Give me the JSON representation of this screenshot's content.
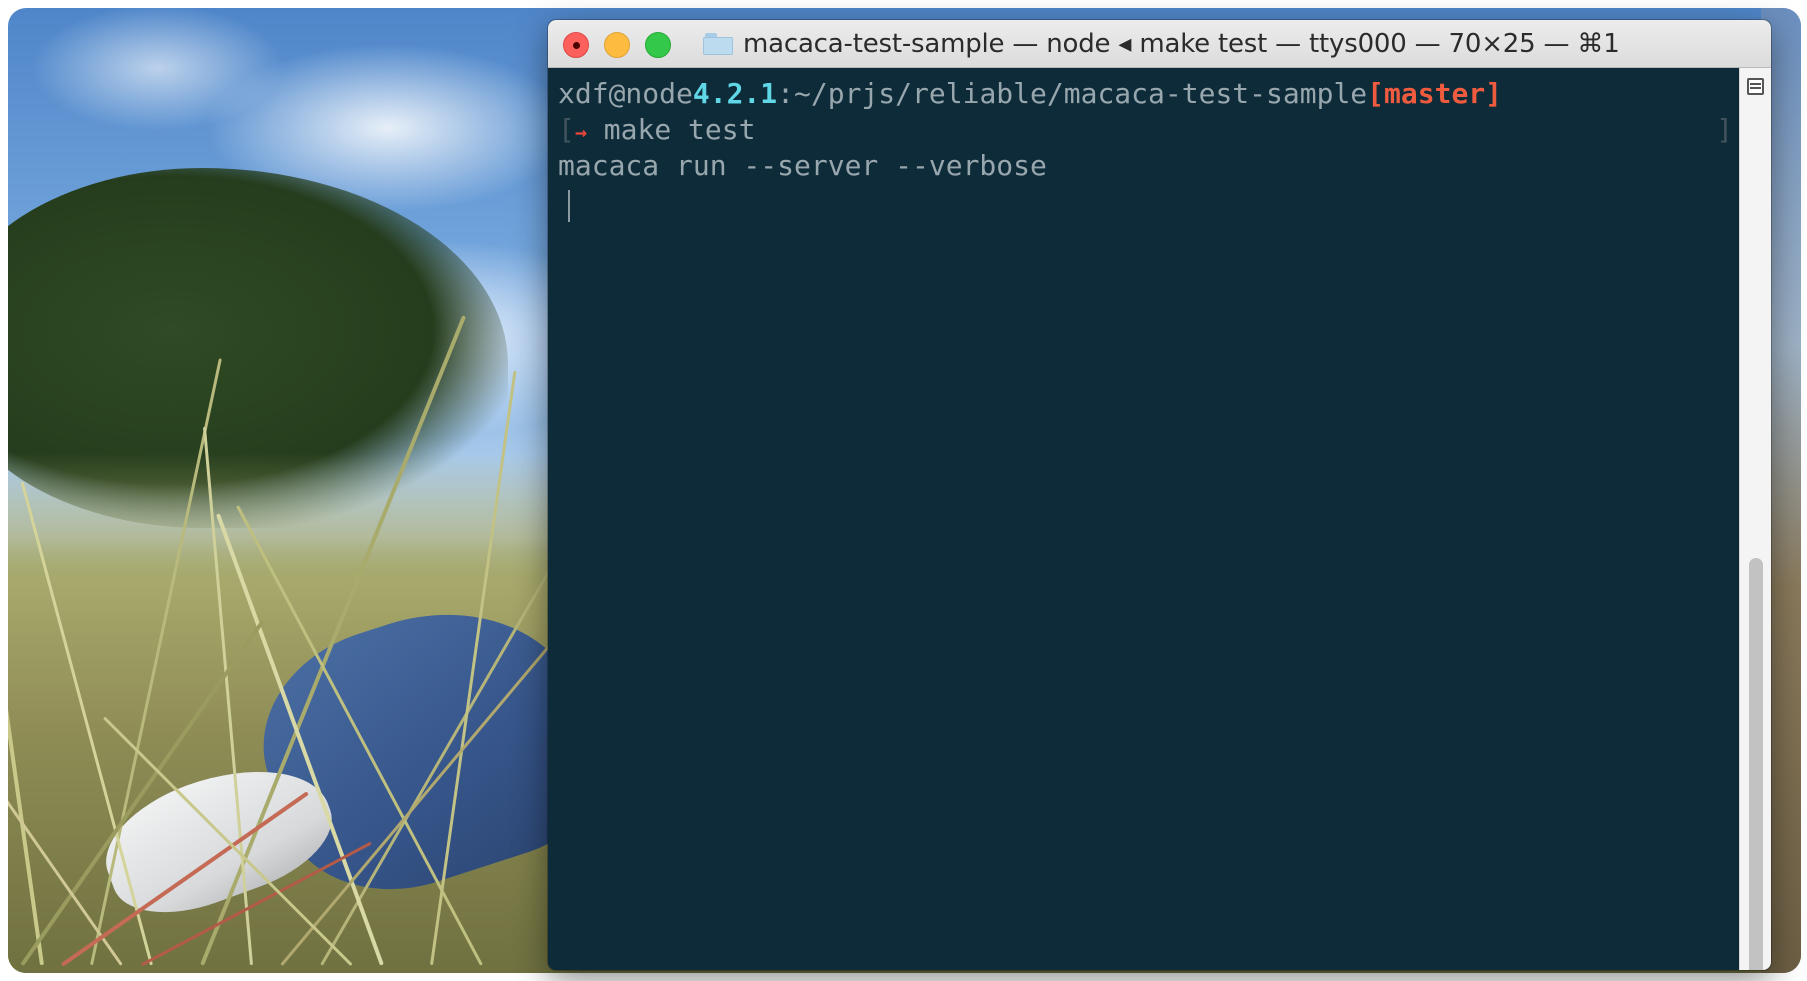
{
  "window": {
    "title": "macaca-test-sample — node ◂ make test — ttys000 — 70×25 — ⌘1"
  },
  "terminal": {
    "prompt": {
      "user_host": "xdf@node",
      "node_version": "4.2.1",
      "path": ":~/prjs/reliable/macaca-test-sample",
      "branch": "[master]"
    },
    "command_line": {
      "open_bracket": "[",
      "arrow": "→",
      "command": " make test",
      "close_bracket": "]"
    },
    "output_lines": [
      "macaca run --server --verbose"
    ]
  },
  "colors": {
    "terminal_background": "#0e2b39",
    "text": "#98a6ad",
    "version_highlight": "#5fd7e6",
    "branch_highlight": "#ef5b3f",
    "close_button": "#fc605c",
    "minimize_button": "#fdbc40",
    "zoom_button": "#34c84a"
  },
  "icons": {
    "folder": "folder-icon",
    "scroll_top": "scroll-view-icon"
  }
}
